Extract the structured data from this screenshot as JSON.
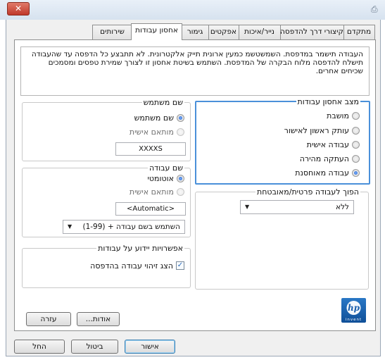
{
  "window": {
    "close_glyph": "✕",
    "printer_glyph": "⎙"
  },
  "tabs": [
    {
      "label": "מתקדם"
    },
    {
      "label": "קיצורי דרך להדפסה"
    },
    {
      "label": "נייר/איכות"
    },
    {
      "label": "אפקטים"
    },
    {
      "label": "גימור"
    },
    {
      "label": "אחסון עבודות"
    },
    {
      "label": "שירותים"
    }
  ],
  "active_tab": "אחסון עבודות",
  "description": "העבודה תישמר במדפסת. השמשטשמ כמעין ארונית תייק אלקטרונית. לא תתבצע כל הדפסה עד שהעבודה תישלח להדפסה מלוח הבקרה של המדפסת. השתמש בשיטת אחסון זו לצורך שמירת טפסים ומסמכים שכיחים אחרים.",
  "job_storage_mode": {
    "legend": "מצב אחסון עבודות",
    "options": [
      {
        "label": "מושבת",
        "checked": false
      },
      {
        "label": "עותק ראשון לאישור",
        "checked": false
      },
      {
        "label": "עבודה אישית",
        "checked": false
      },
      {
        "label": "העתקה מהירה",
        "checked": false
      },
      {
        "label": "עבודה מאוחסנת",
        "checked": true
      }
    ]
  },
  "private_job": {
    "legend": "הפוך לעבודה פרטית/מאובטחת",
    "dropdown_value": "ללא"
  },
  "user_name": {
    "legend": "שם משתמש",
    "option_default": "שם משתמש",
    "option_custom": "מותאם אישית",
    "custom_value": "XXXXS"
  },
  "job_name": {
    "legend": "שם עבודה",
    "option_auto": "אוטומטי",
    "option_custom": "מותאם אישית",
    "custom_value": "<Automatic>",
    "dropdown_value": "השתמש בשם עבודה + (1-99)"
  },
  "notification": {
    "legend": "אפשרויות יידוע על עבודות",
    "checkbox_label": "הצג זיהוי עבודה בהדפסה",
    "checked": true
  },
  "logo": {
    "mark": "hp",
    "tagline": "invent",
    "brand_color": "#1a5fad"
  },
  "buttons": {
    "about": "אודות...",
    "help": "עזרה",
    "ok": "אישור",
    "cancel": "ביטול",
    "apply": "החל"
  }
}
